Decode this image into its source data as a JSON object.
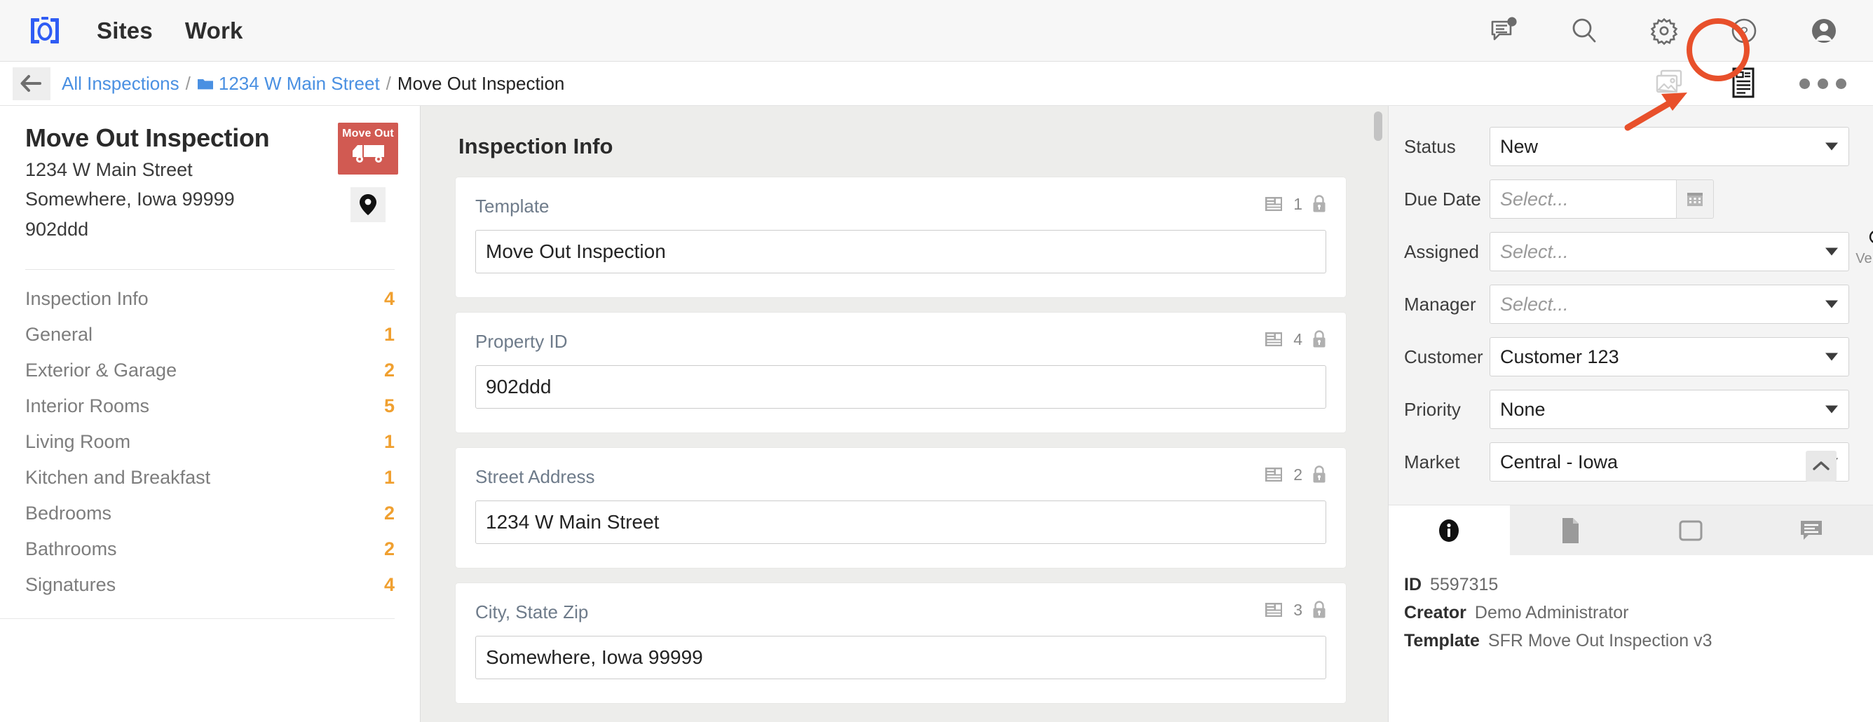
{
  "topbar": {
    "logo_name": "brackets-o-logo",
    "nav": [
      {
        "label": "Sites"
      },
      {
        "label": "Work"
      }
    ],
    "icons": [
      {
        "name": "messages-icon"
      },
      {
        "name": "search-icon"
      },
      {
        "name": "gear-icon"
      },
      {
        "name": "help-icon"
      },
      {
        "name": "avatar-icon"
      }
    ]
  },
  "breadcrumb": {
    "back_label": "back",
    "items": [
      {
        "label": "All Inspections",
        "type": "link"
      },
      {
        "label": "1234 W Main Street",
        "type": "link-folder"
      },
      {
        "label": "Move Out Inspection",
        "type": "current"
      }
    ],
    "separator": "/",
    "actions": [
      {
        "name": "photos-icon"
      },
      {
        "name": "report-icon"
      },
      {
        "name": "more-options-icon"
      }
    ],
    "annotation_color": "#e8502b"
  },
  "sidebar": {
    "title": "Move Out Inspection",
    "address_line1": "1234 W Main Street",
    "address_line2": "Somewhere, Iowa 99999",
    "address_line3": "902ddd",
    "badge": {
      "label": "Move Out",
      "icon": "moving-truck-icon",
      "color": "#d15a52"
    },
    "pin_icon": "map-pin-icon",
    "items": [
      {
        "label": "Inspection Info",
        "count": "4"
      },
      {
        "label": "General",
        "count": "1"
      },
      {
        "label": "Exterior & Garage",
        "count": "2"
      },
      {
        "label": "Interior Rooms",
        "count": "5"
      },
      {
        "label": "Living Room",
        "count": "1"
      },
      {
        "label": "Kitchen and Breakfast",
        "count": "1"
      },
      {
        "label": "Bedrooms",
        "count": "2"
      },
      {
        "label": "Bathrooms",
        "count": "2"
      },
      {
        "label": "Signatures",
        "count": "4"
      }
    ],
    "count_color": "#f0a030"
  },
  "main": {
    "section_title": "Inspection Info",
    "fields": [
      {
        "label": "Template",
        "value": "Move Out Inspection",
        "meta_count": "1",
        "meta_icon": "form-icon",
        "lock_icon": "lock-icon"
      },
      {
        "label": "Property ID",
        "value": "902ddd",
        "meta_count": "4",
        "meta_icon": "form-icon",
        "lock_icon": "lock-icon"
      },
      {
        "label": "Street Address",
        "value": "1234 W Main Street",
        "meta_count": "2",
        "meta_icon": "form-icon",
        "lock_icon": "lock-icon"
      },
      {
        "label": "City, State Zip",
        "value": "Somewhere, Iowa 99999",
        "meta_count": "3",
        "meta_icon": "form-icon",
        "lock_icon": "lock-icon"
      }
    ]
  },
  "rightpanel": {
    "fields": [
      {
        "label": "Status",
        "value": "New",
        "kind": "select",
        "placeholder": ""
      },
      {
        "label": "Due Date",
        "value": "",
        "kind": "date",
        "placeholder": "Select..."
      },
      {
        "label": "Assigned",
        "value": "",
        "kind": "select",
        "placeholder": "Select..."
      },
      {
        "label": "Manager",
        "value": "",
        "kind": "select",
        "placeholder": "Select..."
      },
      {
        "label": "Customer",
        "value": "Customer 123",
        "kind": "select",
        "placeholder": ""
      },
      {
        "label": "Priority",
        "value": "None",
        "kind": "select",
        "placeholder": ""
      },
      {
        "label": "Market",
        "value": "Central - Iowa",
        "kind": "select",
        "placeholder": ""
      }
    ],
    "vendor": {
      "label": "Vendor",
      "icon": "search-icon"
    },
    "scroll_top_icon": "chevron-up-icon",
    "tabs": [
      {
        "name": "info-tab",
        "icon": "info-icon",
        "active": true
      },
      {
        "name": "documents-tab",
        "icon": "document-icon",
        "active": false
      },
      {
        "name": "window-tab",
        "icon": "window-icon",
        "active": false
      },
      {
        "name": "comments-tab",
        "icon": "comment-icon",
        "active": false
      }
    ],
    "info": [
      {
        "key": "ID",
        "value": "5597315"
      },
      {
        "key": "Creator",
        "value": "Demo Administrator"
      },
      {
        "key": "Template",
        "value": "SFR Move Out Inspection v3"
      }
    ]
  }
}
